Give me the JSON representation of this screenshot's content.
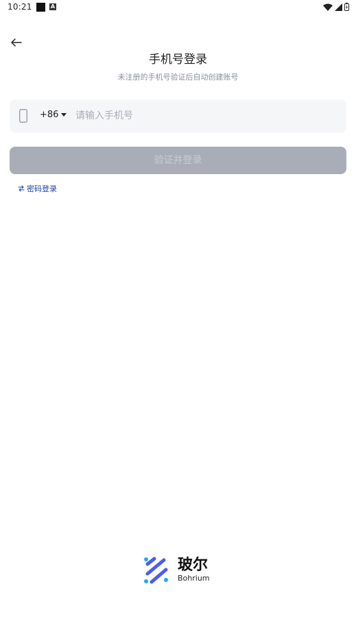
{
  "status_bar": {
    "time": "10:21",
    "a_badge": "A",
    "icons": [
      "wifi-icon",
      "signal-icon",
      "battery-icon"
    ]
  },
  "header": {
    "back_icon": "back-arrow-icon",
    "title": "手机号登录",
    "subtitle": "未注册的手机号验证后自动创建账号"
  },
  "phone_field": {
    "icon": "phone-icon",
    "country_code": "+86",
    "placeholder": "请输入手机号",
    "value": ""
  },
  "submit_button": {
    "label": "验证并登录",
    "enabled": false
  },
  "password_login": {
    "icon": "swap-icon",
    "label": "密码登录"
  },
  "brand": {
    "name_cn": "玻尔",
    "name_en": "Bohrium"
  },
  "colors": {
    "accent_link": "#1a3fae",
    "button_disabled": "#a9adb7",
    "input_bg": "#f5f6f8",
    "logo_blue": "#4a5cf0",
    "logo_cyan": "#1ea7fd"
  }
}
